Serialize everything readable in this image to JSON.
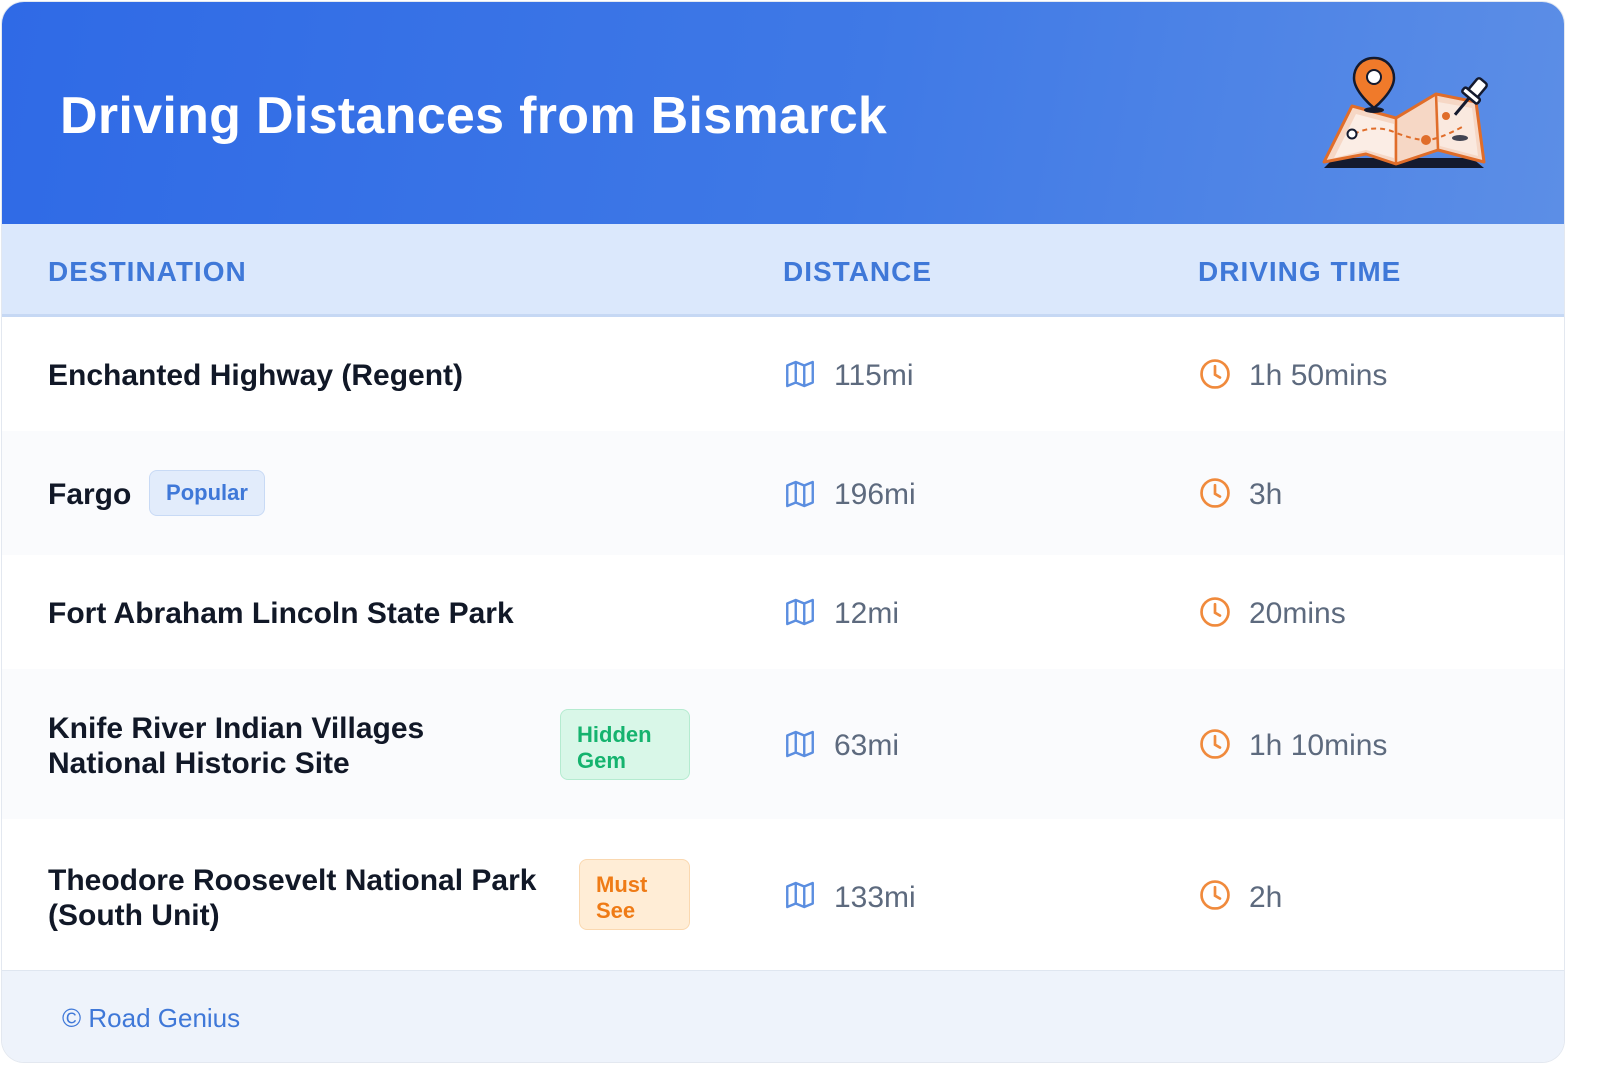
{
  "header": {
    "title": "Driving Distances from Bismarck",
    "illustration": "map-with-pins-icon",
    "gradient_colors": [
      "#2f6ae6",
      "#5c8ee6"
    ]
  },
  "table": {
    "columns": [
      "DESTINATION",
      "DISTANCE",
      "DRIVING TIME"
    ],
    "distance_icon": "map-icon",
    "time_icon": "clock-icon",
    "rows": [
      {
        "destination_lines": [
          "Enchanted Highway (Regent)"
        ],
        "badge": "",
        "distance": "115mi",
        "time": "1h 50mins"
      },
      {
        "destination_lines": [
          "Fargo"
        ],
        "badge": "Popular",
        "distance": "196mi",
        "time": "3h"
      },
      {
        "destination_lines": [
          "Fort Abraham Lincoln State Park"
        ],
        "badge": "",
        "distance": "12mi",
        "time": "20mins"
      },
      {
        "destination_lines": [
          "Knife River Indian Villages",
          "National Historic Site"
        ],
        "badge_lines": [
          "Hidden",
          "Gem"
        ],
        "distance": "63mi",
        "time": "1h 10mins"
      },
      {
        "destination_lines": [
          "Theodore Roosevelt National Park",
          "(South Unit)"
        ],
        "badge_lines": [
          "Must",
          "See"
        ],
        "distance": "133mi",
        "time": "2h"
      }
    ]
  },
  "footer": {
    "credit": "© Road Genius"
  },
  "colors": {
    "accent_blue": "#3f78d8",
    "badge_popular": "#3f78d8",
    "badge_hidden_gem": "#15b36e",
    "badge_must_see": "#ef7b16",
    "clock_orange": "#f08a3c"
  }
}
